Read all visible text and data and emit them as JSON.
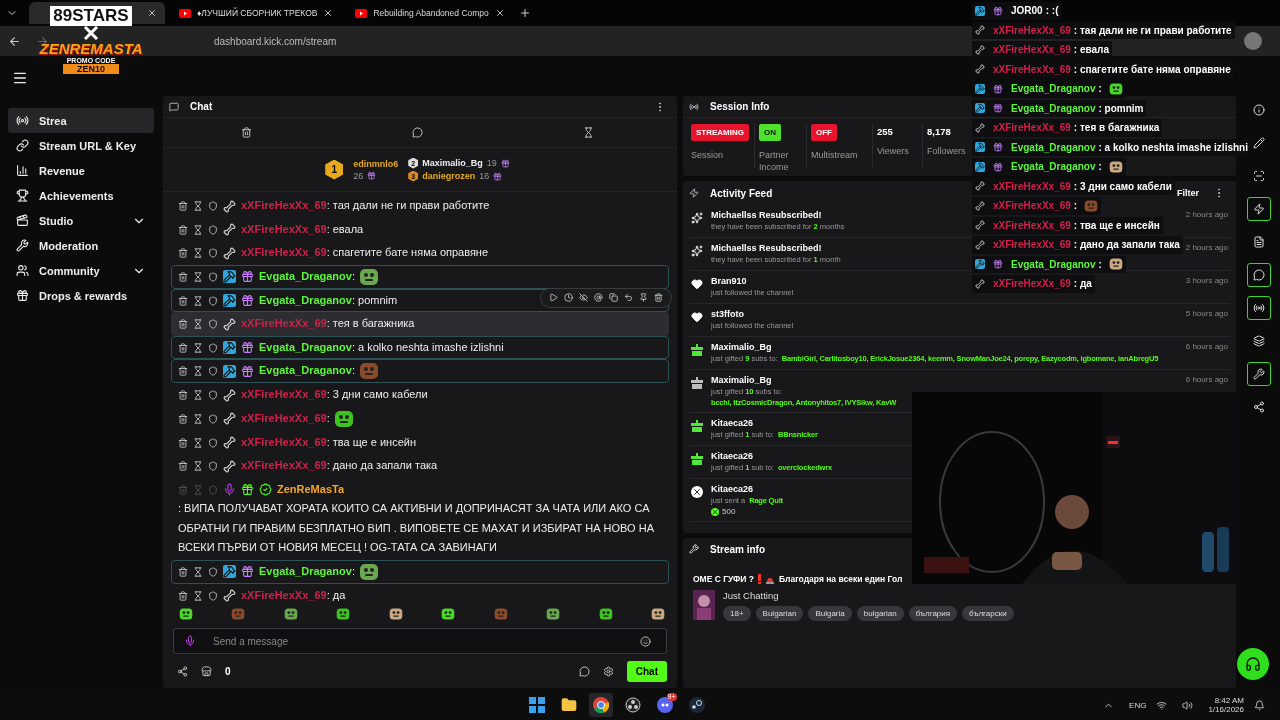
{
  "browser": {
    "tabs": [
      {
        "title": "♦ЛУЧШИЙ СБОРНИК ТРЕКОВ",
        "selected": false
      },
      {
        "title": "Rebuilding Abandoned Compo",
        "selected": false
      }
    ],
    "url": "dashboard.kick.com/stream"
  },
  "stream_overlay": {
    "brand": "89STARS",
    "name": "ZENREMASTA",
    "promo_label": "PROMO CODE",
    "promo_code": "ZEN10"
  },
  "sidebar": {
    "items": [
      {
        "label": "Strea",
        "selected": true,
        "expandable": false
      },
      {
        "label": "Stream URL & Key",
        "selected": false,
        "expandable": false
      },
      {
        "label": "Revenue",
        "selected": false,
        "expandable": false
      },
      {
        "label": "Achievements",
        "selected": false,
        "expandable": false
      },
      {
        "label": "Studio",
        "selected": false,
        "expandable": true
      },
      {
        "label": "Moderation",
        "selected": false,
        "expandable": false
      },
      {
        "label": "Community",
        "selected": false,
        "expandable": true
      },
      {
        "label": "Drops & rewards",
        "selected": false,
        "expandable": false
      }
    ]
  },
  "chat": {
    "title": "Chat",
    "leaderboard": [
      {
        "rank": "1",
        "name": "edinmnlo6",
        "count": "26"
      },
      {
        "rank": "2",
        "name": "Maximalio_Bg",
        "count": "19"
      },
      {
        "rank": "3",
        "name": "daniegrozen",
        "count": "16"
      }
    ],
    "messages": [
      {
        "user": "xXFireHexXx_69",
        "color": "#d41f4a",
        "kind": "sub",
        "text": ": тая дали не ги прави работите",
        "highlighted": false,
        "hovered": false
      },
      {
        "user": "xXFireHexXx_69",
        "color": "#d41f4a",
        "kind": "sub",
        "text": ": евала",
        "highlighted": false,
        "hovered": false
      },
      {
        "user": "xXFireHexXx_69",
        "color": "#d41f4a",
        "kind": "sub",
        "text": ": спагетите бате няма оправяне",
        "highlighted": false,
        "hovered": false
      },
      {
        "user": "Evgata_Draganov",
        "color": "#5df53c",
        "kind": "mod",
        "text": ":",
        "emote": true,
        "highlighted": true,
        "hovered": false
      },
      {
        "user": "Evgata_Draganov",
        "color": "#5df53c",
        "kind": "mod",
        "text": ": pomnim",
        "highlighted": true,
        "hovered": false,
        "toolbar": true
      },
      {
        "user": "xXFireHexXx_69",
        "color": "#d41f4a",
        "kind": "sub",
        "text": ": тея в багажника",
        "highlighted": false,
        "hovered": true
      },
      {
        "user": "Evgata_Draganov",
        "color": "#5df53c",
        "kind": "mod",
        "text": ": a kolko neshta imashe izlishni",
        "highlighted": true,
        "hovered": false
      },
      {
        "user": "Evgata_Draganov",
        "color": "#5df53c",
        "kind": "mod",
        "text": ":",
        "emote": true,
        "highlighted": true,
        "hovered": false
      },
      {
        "user": "xXFireHexXx_69",
        "color": "#d41f4a",
        "kind": "sub",
        "text": ": 3 дни само кабели",
        "highlighted": false,
        "hovered": false
      },
      {
        "user": "xXFireHexXx_69",
        "color": "#d41f4a",
        "kind": "sub",
        "text": ":",
        "emote": true,
        "highlighted": false,
        "hovered": false
      },
      {
        "user": "xXFireHexXx_69",
        "color": "#d41f4a",
        "kind": "sub",
        "text": ": тва ще е инсейн",
        "highlighted": false,
        "hovered": false
      },
      {
        "user": "xXFireHexXx_69",
        "color": "#d41f4a",
        "kind": "sub",
        "text": ": дано да запали така",
        "highlighted": false,
        "hovered": false
      },
      {
        "user": "ZenReMasTa",
        "color": "#f5a623",
        "kind": "owner",
        "text": ": ВИПА ПОЛУЧАВАТ ХОРАТА КОИТО СА АКТИВНИ И ДОПРИНАСЯТ ЗА ЧАТА ИЛИ АКО СА ОБРАТНИ ГИ ПРАВИМ БЕЗПЛАТНО ВИП . ВИПОВЕТЕ СЕ МАХАТ И ИЗБИРАТ НА НОВО НА ВСЕКИ ПЪРВИ ОТ НОВИЯ МЕСЕЦ ! OG-ТАТА СА ЗАВИНАГИ",
        "highlighted": false,
        "hovered": false
      },
      {
        "user": "Evgata_Draganov",
        "color": "#5df53c",
        "kind": "mod",
        "text": ":",
        "emote": true,
        "highlighted": true,
        "hovered": false
      },
      {
        "user": "xXFireHexXx_69",
        "color": "#d41f4a",
        "kind": "sub",
        "text": ": да",
        "highlighted": false,
        "hovered": false
      }
    ],
    "input": {
      "placeholder": "Send a message"
    },
    "kicks_count": "0",
    "send_label": "Chat"
  },
  "session": {
    "title": "Session Info",
    "statuses": [
      {
        "badge": "STREAMING",
        "on": false,
        "label": "Session"
      },
      {
        "badge": "ON",
        "on": true,
        "label": "Partner Income"
      },
      {
        "badge": "OFF",
        "on": false,
        "label": "Multistream"
      }
    ],
    "stats": [
      {
        "value": "255",
        "label": "Viewers"
      },
      {
        "value": "8,178",
        "label": "Followers"
      }
    ]
  },
  "activity": {
    "title": "Activity Feed",
    "filter_label": "Filter",
    "items": [
      {
        "kind": "resub",
        "name": "Michaellss Resubscribed!",
        "detail": "they have been subscribed for **2** months",
        "time": "2 hours ago"
      },
      {
        "kind": "resub",
        "name": "Michaellss Resubscribed!",
        "detail": "they have been subscribed for **1** month",
        "time": "2 hours ago"
      },
      {
        "kind": "follow",
        "name": "Bran910",
        "detail": "just followed the channel",
        "time": "3 hours ago"
      },
      {
        "kind": "follow",
        "name": "st3ffoto",
        "detail": "just followed the channel",
        "time": "5 hours ago"
      },
      {
        "kind": "gift",
        "color": "#53e63a",
        "name": "Maximalio_Bg",
        "detail": "just gifted **9** subs to:",
        "recipients": "BambiGirl, Carlitosboy10, ErickJosue2364, keemm, SnowManJoe24, porepy, Eazycodm, igbomane, ianAbregU5",
        "time": "6 hours ago"
      },
      {
        "kind": "gift",
        "color": "#bdbdbd",
        "name": "Maximalio_Bg",
        "detail": "just gifted **10** subs to:",
        "recipients": "bcchi, ItzCosmicDragon, Antonyhitos7, IVYSikw, KavW",
        "recipients_wrap": true,
        "time": "6 hours ago"
      },
      {
        "kind": "gift",
        "color": "#53e63a",
        "name": "Kitaeca26",
        "detail": "just gifted **1** sub to:",
        "recipients": "BBnsnicker"
      },
      {
        "kind": "gift",
        "color": "#53e63a",
        "name": "Kitaeca26",
        "detail": "just gifted **1** sub to:",
        "recipients": "overclockedwrx"
      },
      {
        "kind": "kicks",
        "name": "Kitaeca26",
        "detail": "just sent a",
        "recipients": "Rage Quit",
        "amount": "500"
      }
    ]
  },
  "stream_info": {
    "title": "Stream info",
    "stream_title_start": "ОМЕ С ГУФИ ?",
    "stream_title_end": "Благодаря на всеки един Гол",
    "category": "Just Chatting",
    "tags": [
      "18+",
      "Bulgarian",
      "Bulgaria",
      "bulgarian",
      "българия",
      "български"
    ]
  },
  "right_rail": [
    {
      "outlined": false
    },
    {
      "outlined": false
    },
    {
      "outlined": false
    },
    {
      "outlined": true
    },
    {
      "outlined": false
    },
    {
      "outlined": true
    },
    {
      "outlined": true
    },
    {
      "outlined": false
    },
    {
      "outlined": true
    },
    {
      "outlined": false
    }
  ],
  "overlay_chat": [
    {
      "user": "JOR00",
      "color": "#ffffff",
      "kind": "mod",
      "text": ": :("
    },
    {
      "user": "xXFireHexXx_69",
      "color": "#d41f4a",
      "kind": "sub",
      "text": ": тая дали не ги прави работите"
    },
    {
      "user": "xXFireHexXx_69",
      "color": "#d41f4a",
      "kind": "sub",
      "text": ": евала"
    },
    {
      "user": "xXFireHexXx_69",
      "color": "#d41f4a",
      "kind": "sub",
      "text": ": спагетите бате няма оправяне"
    },
    {
      "user": "Evgata_Draganov",
      "color": "#5df53c",
      "kind": "mod",
      "text": ":",
      "emote": true
    },
    {
      "user": "Evgata_Draganov",
      "color": "#5df53c",
      "kind": "mod",
      "text": ": pomnim"
    },
    {
      "user": "xXFireHexXx_69",
      "color": "#d41f4a",
      "kind": "sub",
      "text": ": тея в багажника"
    },
    {
      "user": "Evgata_Draganov",
      "color": "#5df53c",
      "kind": "mod",
      "text": ": a kolko neshta imashe izlishni"
    },
    {
      "user": "Evgata_Draganov",
      "color": "#5df53c",
      "kind": "mod",
      "text": ":",
      "emote": true
    },
    {
      "user": "xXFireHexXx_69",
      "color": "#d41f4a",
      "kind": "sub",
      "text": ": 3 дни само кабели"
    },
    {
      "user": "xXFireHexXx_69",
      "color": "#d41f4a",
      "kind": "sub",
      "text": ":",
      "emote": true
    },
    {
      "user": "xXFireHexXx_69",
      "color": "#d41f4a",
      "kind": "sub",
      "text": ": тва ще е инсейн"
    },
    {
      "user": "xXFireHexXx_69",
      "color": "#d41f4a",
      "kind": "sub",
      "text": ": дано да запали така"
    },
    {
      "user": "Evgata_Draganov",
      "color": "#5df53c",
      "kind": "mod",
      "text": ":",
      "emote": true
    },
    {
      "user": "xXFireHexXx_69",
      "color": "#d41f4a",
      "kind": "sub",
      "text": ": да"
    }
  ],
  "taskbar": {
    "apps": [
      {
        "kind": "windows",
        "active": false
      },
      {
        "kind": "folder",
        "active": false
      },
      {
        "kind": "chrome",
        "active": true
      },
      {
        "kind": "obs",
        "active": false
      },
      {
        "kind": "discord",
        "active": false
      },
      {
        "kind": "steam",
        "active": false
      }
    ],
    "discord_badge": "9+",
    "language": "ENG",
    "time": "8:42 AM",
    "date": "1/16/2026"
  }
}
